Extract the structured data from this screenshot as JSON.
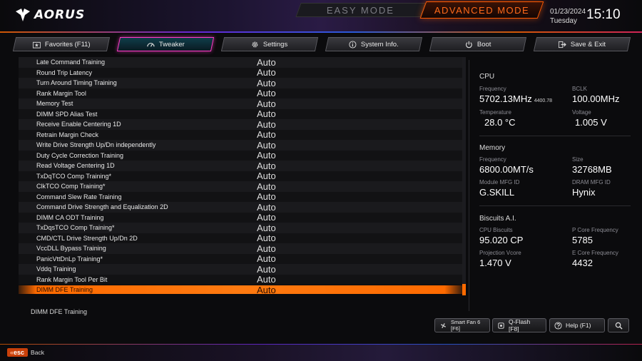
{
  "header": {
    "brand": "AORUS",
    "easy_mode": "EASY MODE",
    "advanced_mode": "ADVANCED MODE",
    "date": "01/23/2024",
    "day": "Tuesday",
    "time": "15:10"
  },
  "tabs": [
    {
      "label": "Favorites (F11)",
      "icon": "star-folder-icon",
      "active": false
    },
    {
      "label": "Tweaker",
      "icon": "speedometer-icon",
      "active": true
    },
    {
      "label": "Settings",
      "icon": "gear-icon",
      "active": false
    },
    {
      "label": "System Info.",
      "icon": "info-icon",
      "active": false
    },
    {
      "label": "Boot",
      "icon": "power-icon",
      "active": false
    },
    {
      "label": "Save & Exit",
      "icon": "exit-icon",
      "active": false
    }
  ],
  "settings": [
    {
      "name": "Late Command Training",
      "value": "Auto"
    },
    {
      "name": "Round Trip Latency",
      "value": "Auto"
    },
    {
      "name": "Turn Around Timing Training",
      "value": "Auto"
    },
    {
      "name": "Rank Margin Tool",
      "value": "Auto"
    },
    {
      "name": "Memory Test",
      "value": "Auto"
    },
    {
      "name": "DIMM SPD Alias Test",
      "value": "Auto"
    },
    {
      "name": "Receive Enable Centering 1D",
      "value": "Auto"
    },
    {
      "name": "Retrain Margin Check",
      "value": "Auto"
    },
    {
      "name": "Write Drive Strength Up/Dn independently",
      "value": "Auto"
    },
    {
      "name": "Duty Cycle Correction Training",
      "value": "Auto"
    },
    {
      "name": "Read Voltage Centering 1D",
      "value": "Auto"
    },
    {
      "name": "TxDqTCO Comp Training*",
      "value": "Auto"
    },
    {
      "name": "ClkTCO Comp Training*",
      "value": "Auto"
    },
    {
      "name": "Command Slew Rate Training",
      "value": "Auto"
    },
    {
      "name": "Command Drive Strength and Equalization 2D",
      "value": "Auto"
    },
    {
      "name": "DIMM CA ODT Training",
      "value": "Auto"
    },
    {
      "name": "TxDqsTCO Comp Training*",
      "value": "Auto"
    },
    {
      "name": "CMD/CTL Drive Strength Up/Dn 2D",
      "value": "Auto"
    },
    {
      "name": "VccDLL Bypass Training",
      "value": "Auto"
    },
    {
      "name": "PanicVttDnLp Training*",
      "value": "Auto"
    },
    {
      "name": "Vddq Training",
      "value": "Auto"
    },
    {
      "name": "Rank Margin Tool Per Bit",
      "value": "Auto"
    },
    {
      "name": "DIMM DFE Training",
      "value": "Auto",
      "selected": true
    }
  ],
  "help_text": "DIMM DFE Training",
  "panel": {
    "cpu": {
      "title": "CPU",
      "frequency_label": "Frequency",
      "frequency_value": "5702.13MHz",
      "frequency_sub": "4400.78",
      "bclk_label": "BCLK",
      "bclk_value": "100.00MHz",
      "temperature_label": "Temperature",
      "temperature_value": "28.0 °C",
      "voltage_label": "Voltage",
      "voltage_value": "1.005 V"
    },
    "memory": {
      "title": "Memory",
      "frequency_label": "Frequency",
      "frequency_value": "6800.00MT/s",
      "size_label": "Size",
      "size_value": "32768MB",
      "module_label": "Module MFG ID",
      "module_value": "G.SKILL",
      "dram_label": "DRAM MFG ID",
      "dram_value": "Hynix"
    },
    "biscuits": {
      "title": "Biscuits A.I.",
      "cpu_biscuits_label": "CPU Biscuits",
      "cpu_biscuits_value": "95.020 CP",
      "pcore_label": "P Core Frequency",
      "pcore_value": "5785",
      "vcore_label": "Projection Vcore",
      "vcore_value": "1.470 V",
      "ecore_label": "E Core Frequency",
      "ecore_value": "4432"
    }
  },
  "buttons": {
    "smart_fan": "Smart Fan 6 [F6]",
    "qflash": "Q-Flash [F8]",
    "help": "Help (F1)"
  },
  "footer": {
    "esc_key": "esc",
    "back_label": "Back"
  },
  "colors": {
    "accent": "#ff6a00",
    "active_tab_border": "#ff3cc8"
  }
}
